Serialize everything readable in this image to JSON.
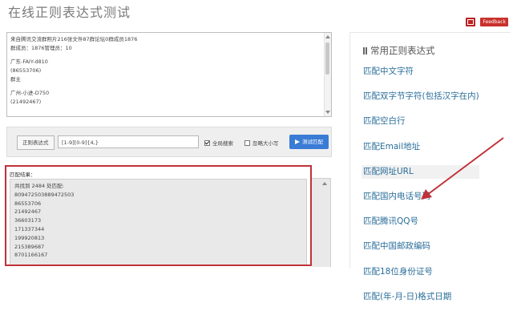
{
  "page": {
    "title": "在线正则表达式测试"
  },
  "topbar": {
    "feedback_label": "Feedback"
  },
  "source": {
    "lines": [
      "来自腾讯交流群照片216张文件87群论坛0群成员1876",
      "群成员：1876管理员：10",
      "",
      "广东-FAIY-d810",
      "(86553706)",
      "群主",
      "",
      "广州-小进-D750",
      "(21492467)"
    ]
  },
  "regex": {
    "label": "正则表达式",
    "value": "[1-9][0-9]{4,}",
    "global_label": "全局搜索",
    "global_checked": true,
    "ignorecase_label": "忽略大小写",
    "ignorecase_checked": false,
    "test_button": "测试匹配"
  },
  "result": {
    "label": "匹配结果：",
    "summary": "共找到 2484 处匹配:",
    "matches": [
      "809472503889472503",
      "86553706",
      "21492467",
      "36603173",
      "171337344",
      "199920813",
      "215389687",
      "8701166167"
    ]
  },
  "sidebar": {
    "heading": "常用正则表达式",
    "links": [
      "匹配中文字符",
      "匹配双字节字符(包括汉字在内)",
      "匹配空白行",
      "匹配Email地址",
      "匹配网址URL",
      "匹配国内电话号码",
      "匹配腾讯QQ号",
      "匹配中国邮政编码",
      "匹配18位身份证号",
      "匹配(年-月-日)格式日期"
    ],
    "highlighted_index": 4
  },
  "annotation": {
    "arrow_color": "#c0323a",
    "box_color": "#c0323a"
  }
}
